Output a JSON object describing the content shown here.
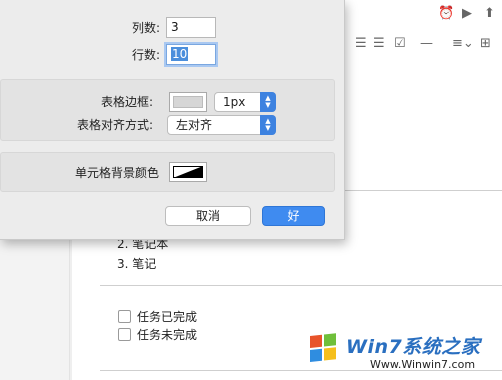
{
  "dialog": {
    "columns_label": "列数:",
    "columns_value": "3",
    "rows_label": "行数:",
    "rows_value": "10",
    "border_label": "表格边框:",
    "border_width": "1px",
    "align_label": "表格对齐方式:",
    "align_value": "左对齐",
    "cell_bg_label": "单元格背景颜色",
    "cancel_label": "取消",
    "ok_label": "好"
  },
  "document": {
    "list_items": [
      "2.  笔记本",
      "3.  笔记"
    ],
    "tasks": [
      "任务已完成",
      "任务未完成"
    ]
  },
  "toolbar": {
    "icons": [
      "alarm-clock-icon",
      "present-icon",
      "numbered-list-icon",
      "bulleted-list-icon",
      "checkbox-icon",
      "horizontal-rule-icon",
      "align-icon",
      "table-icon"
    ]
  },
  "watermark": {
    "brand": "Win7系统之家",
    "url": "Www.Winwin7.com"
  },
  "colors": {
    "accent": "#3f8bf0",
    "dialog_bg": "#ececec"
  }
}
